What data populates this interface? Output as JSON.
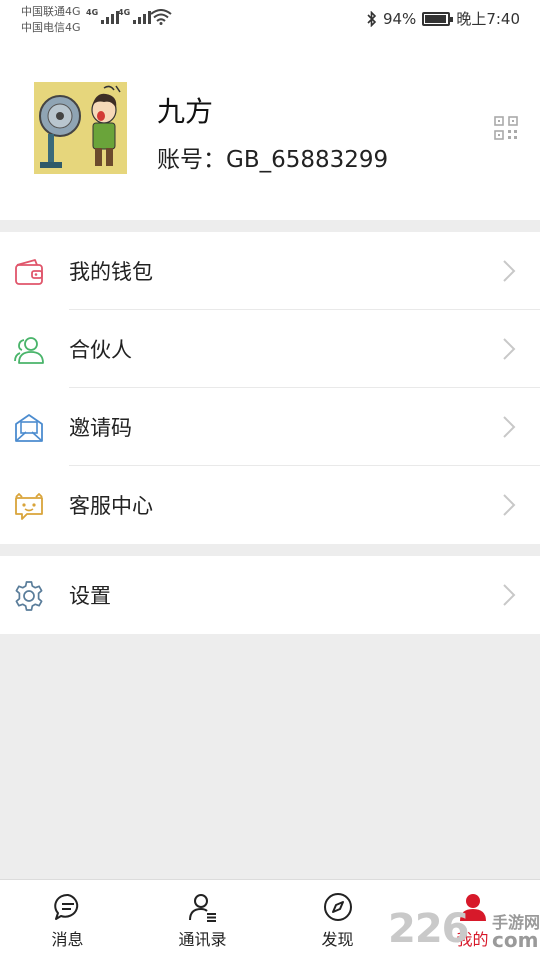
{
  "status_bar": {
    "carrier_1": "中国联通4G",
    "carrier_2": "中国电信4G",
    "net_tag": "4G",
    "battery_percent": "94%",
    "battery_level": 0.94,
    "time": "晚上7:40"
  },
  "profile": {
    "name": "九方",
    "account": "账号：GB_65883299"
  },
  "menu": {
    "items": [
      {
        "label": "我的钱包",
        "icon": "wallet-icon",
        "color": "#e0566b"
      },
      {
        "label": "合伙人",
        "icon": "partner-icon",
        "color": "#49b46a"
      },
      {
        "label": "邀请码",
        "icon": "invite-code-icon",
        "color": "#4c8ccf"
      },
      {
        "label": "客服中心",
        "icon": "customer-service-icon",
        "color": "#d9a43a"
      }
    ],
    "settings": {
      "label": "设置",
      "icon": "gear-icon",
      "color": "#5a7d9a"
    }
  },
  "tabbar": {
    "tabs": [
      {
        "label": "消息",
        "icon": "chat-bubble-icon"
      },
      {
        "label": "通讯录",
        "icon": "contacts-icon"
      },
      {
        "label": "发现",
        "icon": "compass-icon"
      },
      {
        "label": "我的",
        "icon": "person-icon",
        "active": true
      }
    ],
    "active_color": "#d7192a"
  },
  "watermark": {
    "number": "226",
    "site_line1": "手游网",
    "site_line2": "com"
  }
}
